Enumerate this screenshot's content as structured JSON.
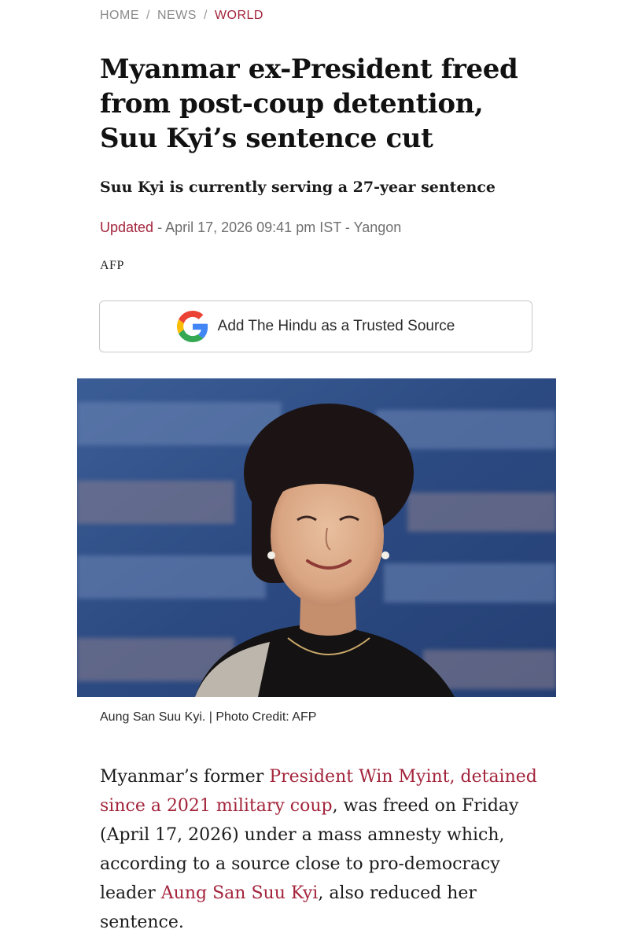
{
  "breadcrumb": {
    "items": [
      "HOME",
      "NEWS",
      "WORLD"
    ],
    "separator": "/"
  },
  "article": {
    "headline": "Myanmar ex-President freed from post-coup detention, Suu Kyi’s sentence cut",
    "subheadline": "Suu Kyi is currently serving a 27-year sentence",
    "updated_label": "Updated",
    "updated_text": " - April 17, 2026 09:41 pm IST - Yangon",
    "agency": "AFP",
    "trusted_source_button": "Add The Hindu as a Trusted Source",
    "trusted_source_icon": "google-g-icon",
    "photo_caption": "Aung San Suu Kyi. | Photo Credit: AFP",
    "body": {
      "part1": "Myanmar’s former ",
      "link1": "President Win Myint, detained since a 2021 military coup",
      "part2": ", was freed on Friday (April 17, 2026) under a mass amnesty which, according to a source close to pro-democracy leader ",
      "link2": "Aung San Suu Kyi",
      "part3": ", also reduced her sentence."
    }
  },
  "colors": {
    "accent": "#a3243b",
    "text": "#1a1a1a",
    "muted": "#6f6f6f",
    "photo_background": "#2d4d84"
  }
}
